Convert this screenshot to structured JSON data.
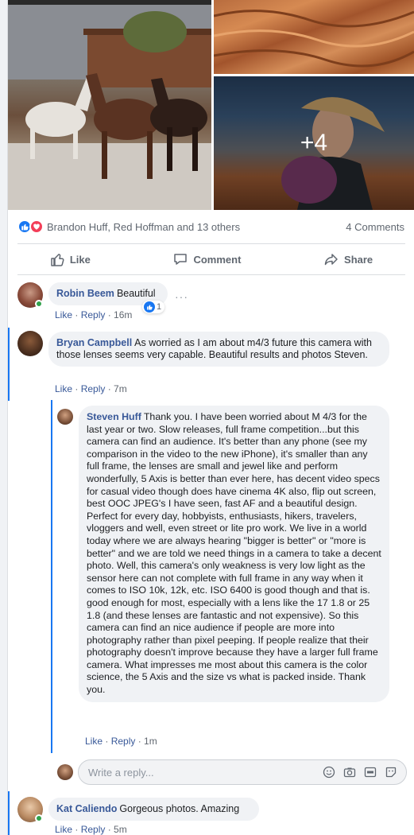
{
  "post": {
    "photo_overflow": "+4",
    "reactors": "Brandon Huff, Red Hoffman and 13 others",
    "comment_count": "4 Comments",
    "actions": {
      "like": "Like",
      "comment": "Comment",
      "share": "Share"
    }
  },
  "comments": [
    {
      "author": "Robin Beem",
      "text": "Beautiful",
      "like": "Like",
      "reply": "Reply",
      "time": "16m",
      "reaction_count": "1",
      "more": "···"
    },
    {
      "author": "Bryan Campbell",
      "text": "As worried as I am about m4/3 future this camera with those lenses seems very capable. Beautiful results and photos Steven.",
      "like": "Like",
      "reply": "Reply",
      "time": "7m"
    },
    {
      "author": "Steven Huff",
      "text": "Thank you. I have been worried about M 4/3 for the last year or two. Slow releases, full frame competition...but this camera can find an audience. It's better than any phone (see my comparison in the video to the new iPhone), it's smaller than any full frame, the lenses are small and jewel like and perform wonderfully, 5 Axis is better than ever here, has decent video specs for casual video though does have cinema 4K also, flip out screen, best OOC JPEG's I have seen, fast AF and a beautiful design. Perfect for every day, hobbyists, enthusiasts, hikers, travelers, vloggers and well, even street or lite pro work. We live in a world today where we are always hearing \"bigger is better\" or \"more is better\" and we are told we need things in a camera to take a decent photo. Well, this camera's only weakness is very low light as the sensor here can not complete with full frame in any way when it comes to ISO 10k, 12k, etc. ISO 6400 is good though and that is. good enough for most, especially with a lens like the 17 1.8 or 25 1.8 (and these lenses are fantastic and not expensive). So this camera can find an nice audience if people are more into photography rather than pixel peeping. If people realize that their photography doesn't improve because they have a larger full frame camera. What impresses me most about this camera is the color science, the 5 Axis and the size vs what is packed inside. Thank you.",
      "like": "Like",
      "reply": "Reply",
      "time": "1m"
    },
    {
      "author": "Kat Caliendo",
      "text": "Gorgeous photos. Amazing",
      "like": "Like",
      "reply": "Reply",
      "time": "5m"
    }
  ],
  "reply_box": {
    "placeholder": "Write a reply..."
  },
  "colors": {
    "link": "#385898",
    "accent": "#1877f2",
    "love": "#f33e58",
    "bubble": "#f0f2f5",
    "online": "#31a24c"
  }
}
